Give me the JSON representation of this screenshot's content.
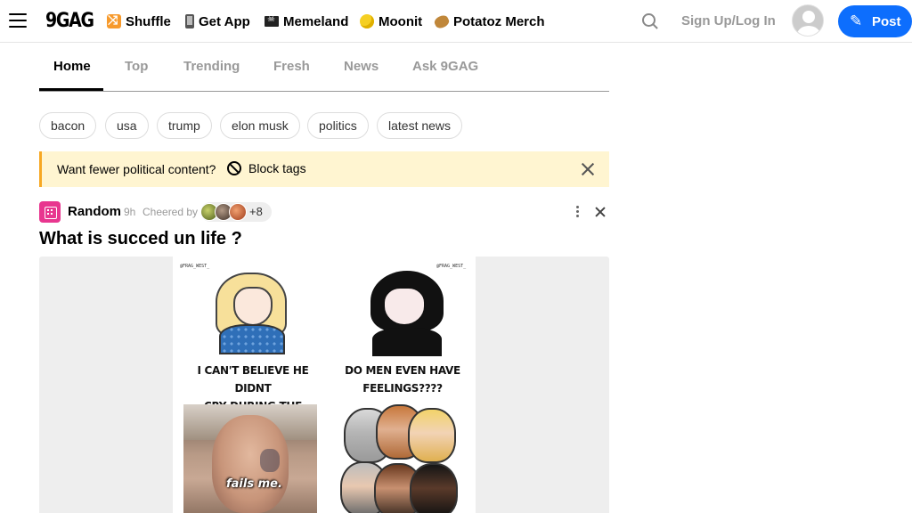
{
  "header": {
    "logo": "9GAG",
    "nav": [
      {
        "label": "Shuffle",
        "icon": "shuffle-icon"
      },
      {
        "label": "Get App",
        "icon": "phone-icon"
      },
      {
        "label": "Memeland",
        "icon": "pirate-flag-icon"
      },
      {
        "label": "Moonit",
        "icon": "moon-coin-icon"
      },
      {
        "label": "Potatoz Merch",
        "icon": "potato-icon"
      }
    ],
    "signup_label": "Sign Up/Log In",
    "post_label": "Post"
  },
  "tabs": [
    {
      "label": "Home",
      "active": true
    },
    {
      "label": "Top",
      "active": false
    },
    {
      "label": "Trending",
      "active": false
    },
    {
      "label": "Fresh",
      "active": false
    },
    {
      "label": "News",
      "active": false
    },
    {
      "label": "Ask 9GAG",
      "active": false
    }
  ],
  "tags": [
    "bacon",
    "usa",
    "trump",
    "elon musk",
    "politics",
    "latest news"
  ],
  "banner": {
    "text": "Want fewer political content?",
    "action_label": "Block tags"
  },
  "post": {
    "section": "Random",
    "time": "9h",
    "cheered_label": "Cheered by",
    "cheer_extra": "+8",
    "title": "What is succed un life ?",
    "meme": {
      "watermark_left": "@FRAG_WEST_",
      "watermark_right": "@FRAG_WEST_",
      "caption_left_1": "I CAN'T BELIEVE HE DIDNT",
      "caption_left_2": "CRY DURING THE TITANIC",
      "caption_right_1": "DO MEN EVEN HAVE",
      "caption_right_2": "FEELINGS????",
      "photo_subtitle": "fails me."
    }
  },
  "colors": {
    "accent": "#0d6efd",
    "banner_bg": "#fff5d1",
    "banner_border": "#f7a823",
    "section_icon": "#e8368f"
  }
}
